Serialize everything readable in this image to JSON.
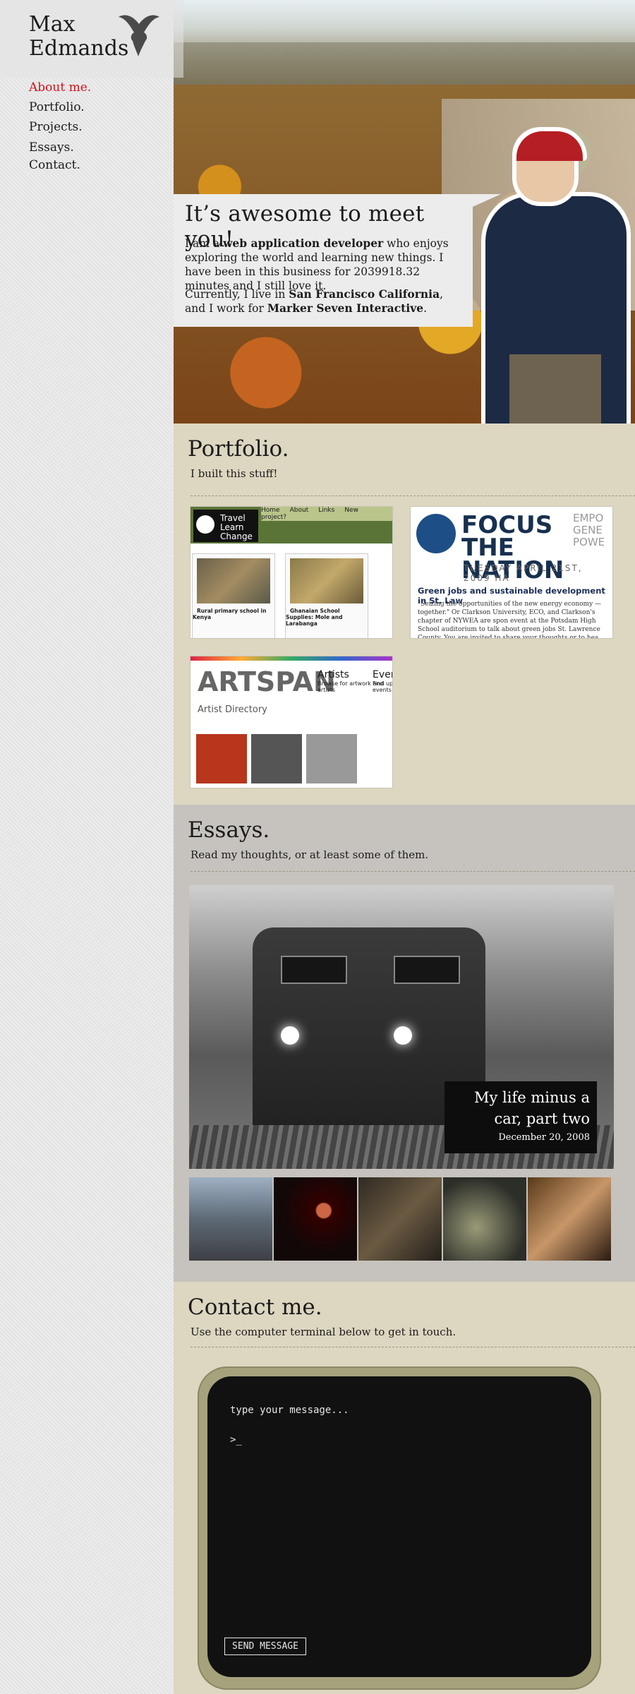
{
  "sidebar": {
    "logo_line1": "Max",
    "logo_line2": "Edmands",
    "nav": [
      {
        "label": "About me.",
        "active": true
      },
      {
        "label": "Portfolio."
      },
      {
        "label": "Projects."
      },
      {
        "label": "Essays."
      },
      {
        "label": "Contact."
      }
    ],
    "active_color": "#d0101c"
  },
  "intro": {
    "heading": "It’s awesome to meet you!",
    "p1_a": "I am a ",
    "p1_bold": "web application developer",
    "p1_b": " who enjoys exploring the world and learning new things. I have been in this business for 2039918.32 minutes and I still love it.",
    "p2_a": "Currently, I live in ",
    "p2_bold1": "San Francisco California",
    "p2_b": ", and I work for ",
    "p2_bold2": "Marker Seven Interactive",
    "p2_c": "."
  },
  "portfolio": {
    "title": "Portfolio.",
    "subtitle": "I built this stuff!",
    "items": [
      {
        "name": "Travel Learn Change",
        "nav": [
          "Home",
          "About",
          "Links",
          "New project?"
        ],
        "card1": "Rural primary school in Kenya",
        "card2": "Ghanaian School Supplies: Mole and Larabanga"
      },
      {
        "name": "FOCUS THE NATION",
        "side": "EMPO GENE POWE",
        "date": "TUESDAY APRIL 21ST, 2009 HA",
        "headline": "Green jobs and sustainable development in St. Law",
        "body": "\"Seizing the opportunities of the new energy economy — together.\" Or Clarkson University, ECO, and Clarkson's chapter of NYWEA are spon event at the Potsdam High School auditorium to talk about green jobs St. Lawrence County. You are invited to share your thoughts or to hea"
      },
      {
        "name": "ARTSPAN",
        "artists": "Artists",
        "artists_sub": "Browse for artwork and artists",
        "events": "Even",
        "events_sub": "Find up events n",
        "directory": "Artist Directory"
      }
    ]
  },
  "essays": {
    "title": "Essays.",
    "subtitle": "Read my thoughts, or at least some of them.",
    "feature_title": "My life minus a car, part two",
    "feature_date": "December 20, 2008"
  },
  "contact": {
    "title": "Contact me.",
    "subtitle": "Use the computer terminal below to get in touch.",
    "prompt": "type your message...",
    "cursor": ">_",
    "send_label": "SEND MESSAGE"
  }
}
